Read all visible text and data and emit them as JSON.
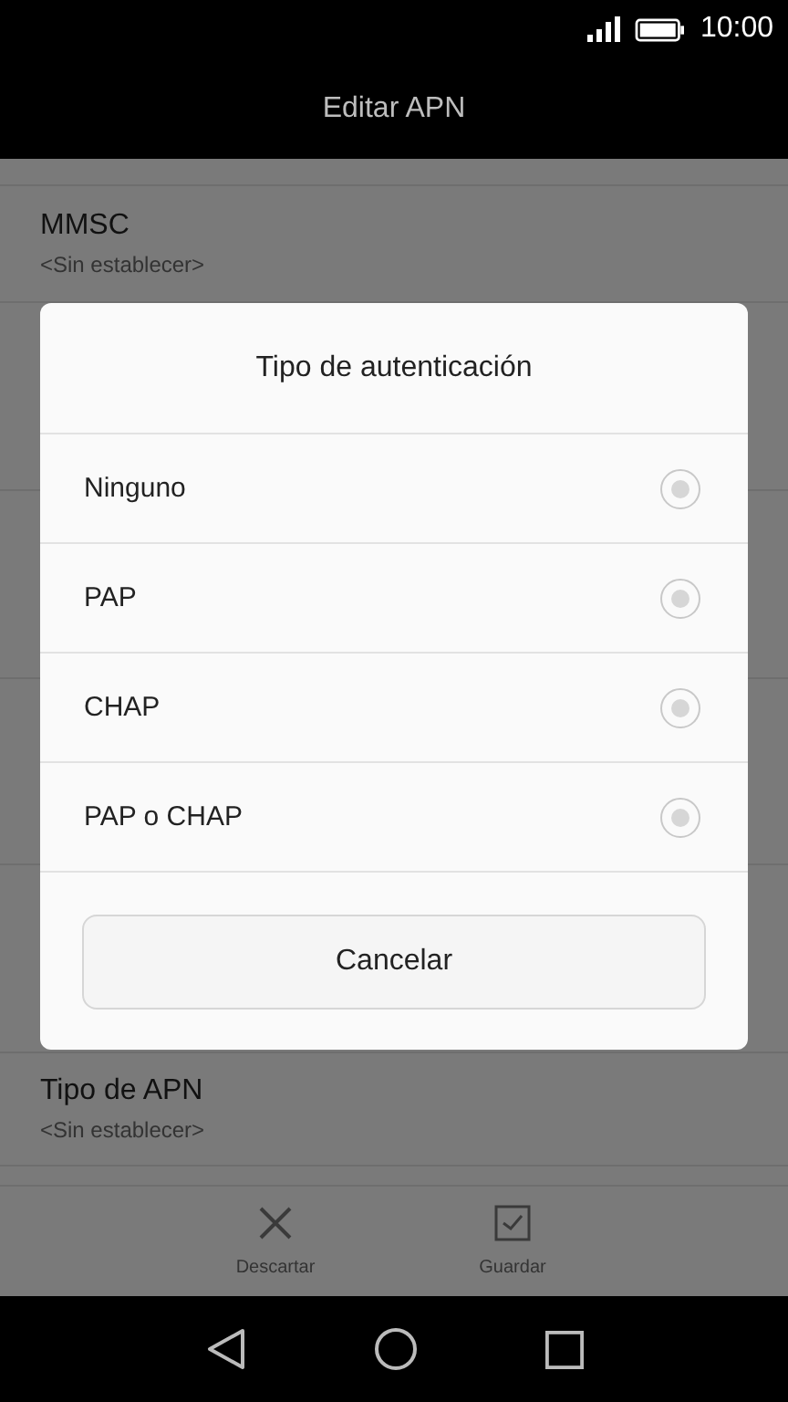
{
  "status_bar": {
    "time": "10:00"
  },
  "title": "Editar APN",
  "settings": [
    {
      "label": "MMSC",
      "value": "<Sin establecer>"
    },
    {
      "label": "Tipo de APN",
      "value": "<Sin establecer>"
    }
  ],
  "dialog": {
    "title": "Tipo de autenticación",
    "options": [
      {
        "label": "Ninguno",
        "selected": false
      },
      {
        "label": "PAP",
        "selected": false
      },
      {
        "label": "CHAP",
        "selected": false
      },
      {
        "label": "PAP o CHAP",
        "selected": false
      }
    ],
    "button": "Cancelar"
  },
  "actions": [
    {
      "kind": "discard",
      "label": "Descartar"
    },
    {
      "kind": "save",
      "label": "Guardar"
    }
  ]
}
